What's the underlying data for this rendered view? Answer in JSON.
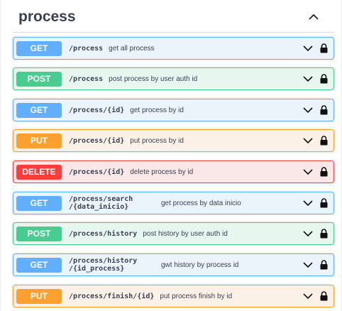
{
  "tag": {
    "title": "process",
    "collapse_icon": "chevron-up-icon"
  },
  "colors": {
    "get": "#61affe",
    "post": "#49cc90",
    "put": "#fca130",
    "delete": "#f93e3e",
    "text": "#3b4151"
  },
  "operations": [
    {
      "method": "GET",
      "path": "/process",
      "summary": "get all process"
    },
    {
      "method": "POST",
      "path": "/process",
      "summary": "post process by user auth id"
    },
    {
      "method": "GET",
      "path": "/process/{id}",
      "summary": "get process by id"
    },
    {
      "method": "PUT",
      "path": "/process/{id}",
      "summary": "put process by id"
    },
    {
      "method": "DELETE",
      "path": "/process/{id}",
      "summary": "delete process by id"
    },
    {
      "method": "GET",
      "path": "/process/search\n/{data_inicio}",
      "summary": "get process by data inicio"
    },
    {
      "method": "POST",
      "path": "/process/history",
      "summary": "post history by user auth id"
    },
    {
      "method": "GET",
      "path": "/process/history\n/{id_process}",
      "summary": "gwt history by process id"
    },
    {
      "method": "PUT",
      "path": "/process/finish/{id}",
      "summary": "put process finish by id"
    }
  ]
}
